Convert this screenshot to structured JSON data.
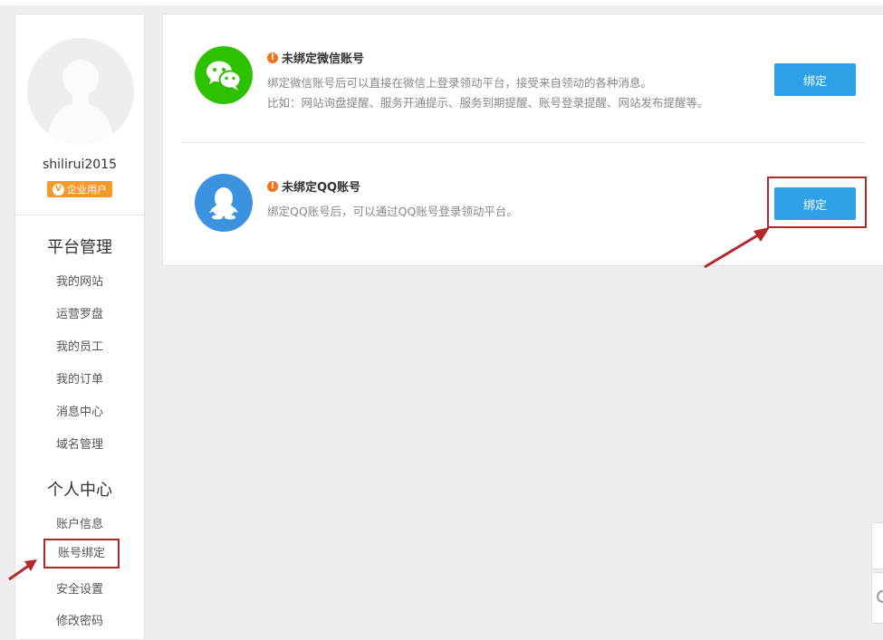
{
  "sidebar": {
    "username": "shilirui2015",
    "badge_label": "企业用户",
    "badge_icon": "v-icon",
    "section_platform": "平台管理",
    "platform_items": [
      "我的网站",
      "运营罗盘",
      "我的员工",
      "我的订单",
      "消息中心",
      "域名管理"
    ],
    "section_personal": "个人中心",
    "personal_items": [
      "账户信息",
      "账号绑定",
      "安全设置",
      "修改密码"
    ],
    "active_item": "账号绑定"
  },
  "bindings": {
    "wechat": {
      "title": "未绑定微信账号",
      "desc_line1": "绑定微信账号后可以直接在微信上登录领动平台，接受来自领动的各种消息。",
      "desc_line2": "比如：网站询盘提醒、服务开通提示、服务到期提醒、账号登录提醒、网站发布提醒等。",
      "button": "绑定",
      "icon_color": "#2dc100"
    },
    "qq": {
      "title": "未绑定QQ账号",
      "desc_line1": "绑定QQ账号后，可以通过QQ账号登录领动平台。",
      "button": "绑定",
      "icon_color": "#3b93e0"
    }
  },
  "colors": {
    "accent_button": "#2ea0e6",
    "warning": "#f4711f",
    "badge": "#f39a2b",
    "annotation": "#b3262a"
  }
}
